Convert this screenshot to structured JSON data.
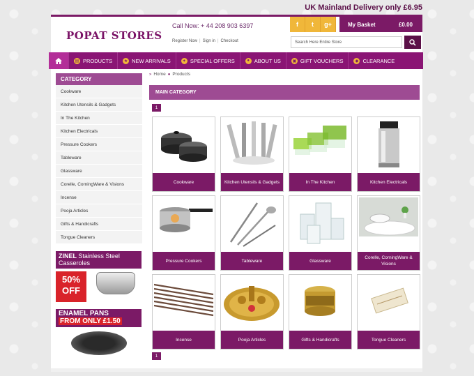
{
  "delivery_text": "UK Mainland Delivery only £6.95",
  "logo": "POPAT STORES",
  "call_now": "Call Now: + 44 208 903 6397",
  "top_links": [
    "Register Now",
    "Sign in",
    "Checkout"
  ],
  "social": [
    "f",
    "t",
    "g+"
  ],
  "basket": {
    "label": "My Basket",
    "total": "£0.00"
  },
  "search": {
    "placeholder": "Search Here Entire Store"
  },
  "nav": [
    "PRODUCTS",
    "NEW ARRIVALS",
    "SPECIAL OFFERS",
    "ABOUT US",
    "GIFT VOUCHERS",
    "CLEARANCE"
  ],
  "sidebar": {
    "heading": "CATEGORY",
    "items": [
      "Cookware",
      "Kitchen Utensils & Gadgets",
      "In The Kitchen",
      "Kitchen Electricals",
      "Pressure Cookers",
      "Tableware",
      "Glassware",
      "Corelle, CorningWare & Visions",
      "Incense",
      "Pooja Articles",
      "Gifts & Handicrafts",
      "Tongue Cleaners"
    ]
  },
  "promo1": {
    "brand": "ZINEL",
    "title": "Stainless Steel",
    "subtitle": "Casseroles",
    "offer_pct": "50%",
    "offer_word": "OFF"
  },
  "promo2": {
    "line1": "ENAMEL PANS",
    "line2": "FROM ONLY £1.50"
  },
  "breadcrumb": [
    "Home",
    "Products"
  ],
  "main_heading": "MAIN CATEGORY",
  "page_number": "1",
  "products": [
    "Cookware",
    "Kitchen Utensils & Gadgets",
    "In The Kitchen",
    "Kitchen Electricals",
    "Pressure Cookers",
    "Tableware",
    "Glassware",
    "Corelle, CorningWare & Visions",
    "Incense",
    "Pooja Articles",
    "Gifts & Handicrafts",
    "Tongue Cleaners"
  ]
}
